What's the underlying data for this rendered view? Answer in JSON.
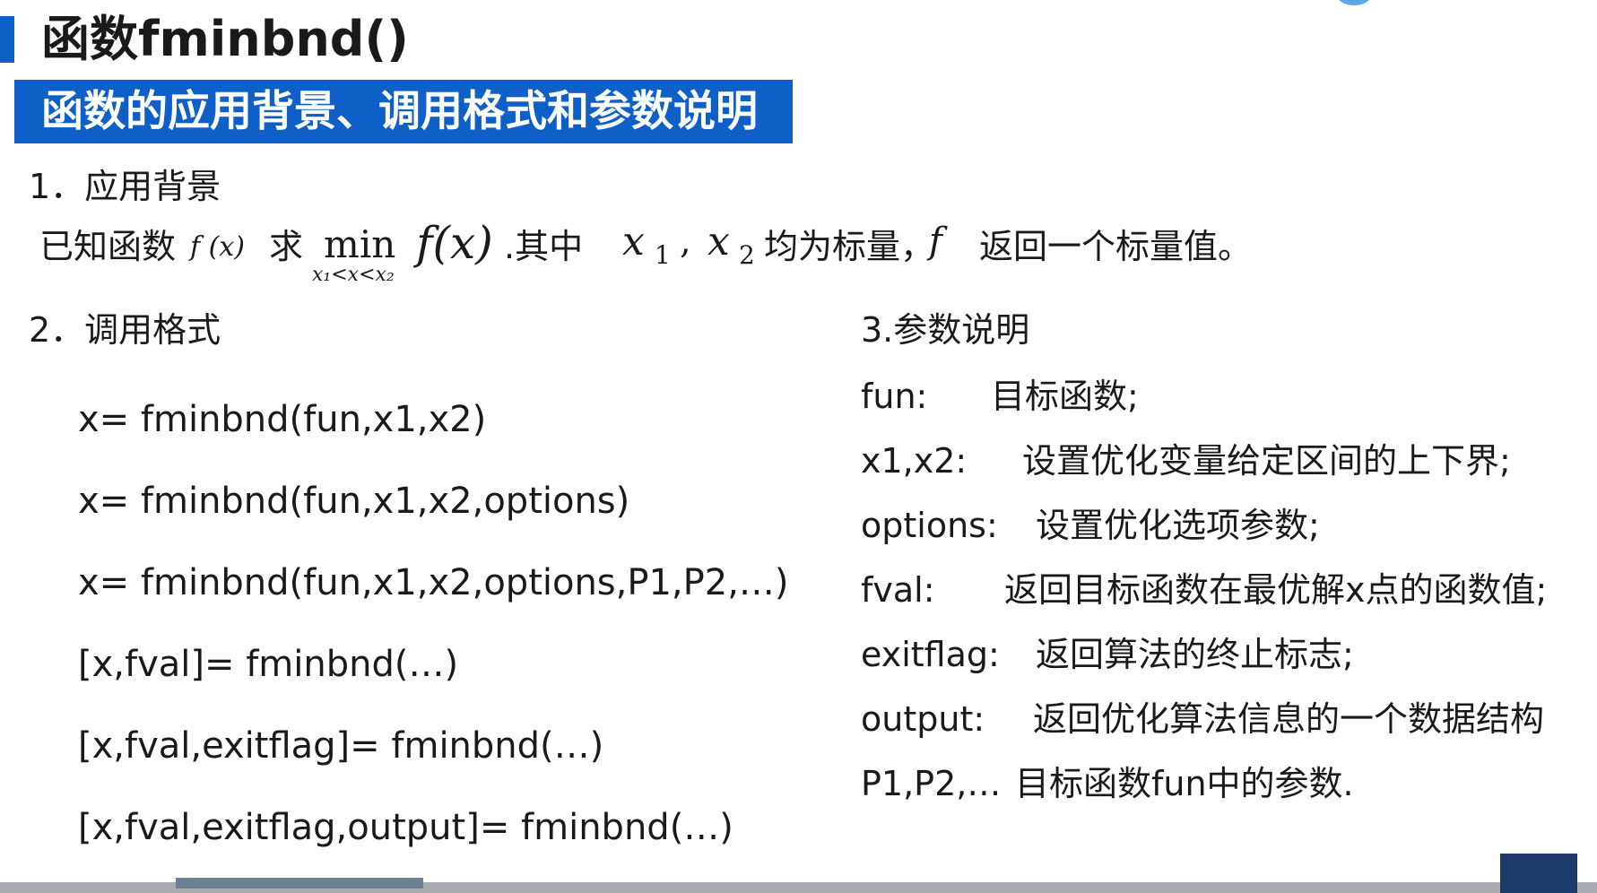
{
  "title": "函数fminbnd()",
  "banner": "函数的应用背景、调用格式和参数说明",
  "sections": {
    "background_heading": "1．应用背景",
    "syntax_heading": "2．调用格式",
    "params_heading": "3.参数说明"
  },
  "background_line": {
    "known_fn": "已知函数",
    "f_of_x_small": "f (x)",
    "seek": "求",
    "min_op": "min",
    "min_constraint": "x₁<x<x₂",
    "f_of_x": "f(x)",
    "where": ".其中",
    "x1_var": "x",
    "x1_sub": "1",
    "comma": ",",
    "x2_var": "x",
    "x2_sub": "2",
    "are_scalars": "均为标量，",
    "f_var": "f",
    "returns_scalar": "返回一个标量值。"
  },
  "syntax": [
    "x= fminbnd(fun,x1,x2)",
    "x= fminbnd(fun,x1,x2,options)",
    "x= fminbnd(fun,x1,x2,options,P1,P2,…)",
    "[x,fval]= fminbnd(…)",
    "[x,fval,exitflag]= fminbnd(…)",
    "[x,fval,exitflag,output]= fminbnd(…)"
  ],
  "params": [
    {
      "name": "fun:",
      "desc": "目标函数;"
    },
    {
      "name": "x1,x2:",
      "desc": "设置优化变量给定区间的上下界;"
    },
    {
      "name": "options:",
      "desc": "设置优化选项参数;"
    },
    {
      "name": "fval:",
      "desc": "返回目标函数在最优解x点的函数值;"
    },
    {
      "name": "exitflag:",
      "desc": "返回算法的终止标志;"
    },
    {
      "name": "output:",
      "desc": "返回优化算法信息的一个数据结构"
    },
    {
      "name": "P1,P2,…",
      "desc": "目标函数fun中的参数."
    }
  ],
  "colors": {
    "accent": "#0f5fc8",
    "text": "#1a1a1a",
    "banner_text": "#ffffff"
  }
}
